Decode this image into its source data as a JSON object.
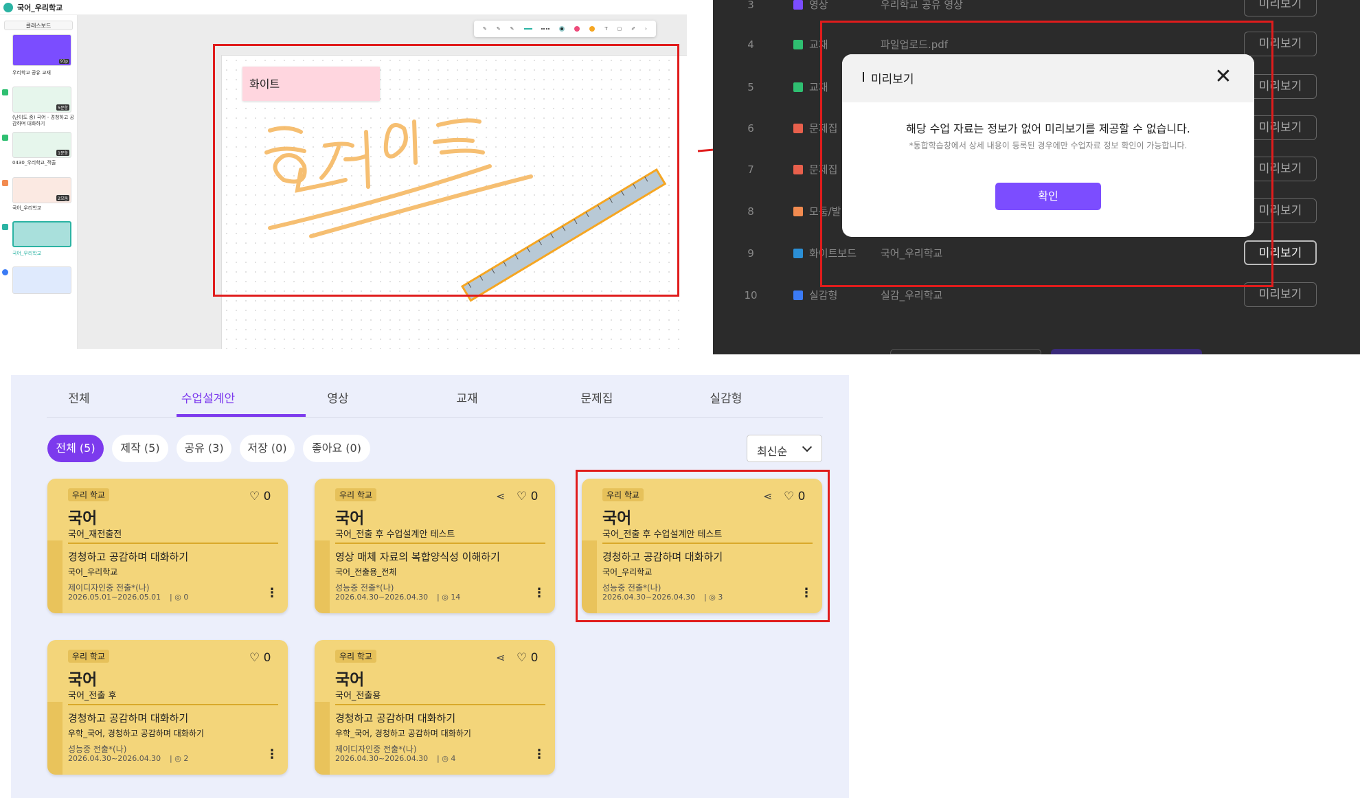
{
  "whiteboard": {
    "title": "국어_우리학교",
    "classboard_label": "클래스보드",
    "thumbnails": [
      {
        "label": "우리학교 공유 교재",
        "badge": "91p"
      },
      {
        "label": "(난이도 중) 국어 - 경청하고 공감하며 대화하기",
        "badge": "5문항"
      },
      {
        "label": "0430_우리학교_적출",
        "badge": "1문항"
      },
      {
        "label": "국어_우리학교",
        "badge": "2모둠"
      },
      {
        "label": "국어_우리학교",
        "badge": ""
      }
    ],
    "sticky_note": "화이트",
    "handwriting": "화이트",
    "colors": {
      "pink_note": "#ffd6df",
      "stroke": "#f5b45a",
      "ruler": "#9fb6c8"
    }
  },
  "dialog": {
    "rows": [
      {
        "n": "3",
        "type": "영상",
        "title": "우리학교 공유 영상",
        "btn": "미리보기"
      },
      {
        "n": "4",
        "type": "교재",
        "title": "파일업로드.pdf",
        "btn": "미리보기"
      },
      {
        "n": "5",
        "type": "교재",
        "title": "",
        "btn": "미리보기"
      },
      {
        "n": "6",
        "type": "문제집",
        "title": "",
        "btn": "미리보기"
      },
      {
        "n": "7",
        "type": "문제집",
        "title": "",
        "btn": "미리보기"
      },
      {
        "n": "8",
        "type": "모둠/발",
        "title": "",
        "btn": "미리보기"
      },
      {
        "n": "9",
        "type": "화이트보드",
        "title": "국어_우리학교",
        "btn": "미리보기"
      },
      {
        "n": "10",
        "type": "실감형",
        "title": "실감_우리학교",
        "btn": "미리보기"
      }
    ],
    "modal_title": "미리보기",
    "modal_message": "해당 수업 자료는 정보가 없어 미리보기를 제공할 수 없습니다.",
    "modal_sub": "*통합학습창에서 상세 내용이 등록된 경우에만 수업자료 정보 확인이 가능합니다.",
    "confirm": "확인"
  },
  "list": {
    "tabs": [
      "전체",
      "수업설계안",
      "영상",
      "교재",
      "문제집",
      "실감형"
    ],
    "active_tab": "수업설계안",
    "filters": [
      "전체 (5)",
      "제작 (5)",
      "공유 (3)",
      "저장 (0)",
      "좋아요 (0)"
    ],
    "sort": "최신순",
    "cards": [
      {
        "tag": "우리 학교",
        "subject": "국어",
        "title": "국어_재전출전",
        "achievement": "경청하고 공감하며 대화하기",
        "meta": "국어_우리학교",
        "author": "제이디자인중 전출*(나)",
        "date": "2026.05.01~2026.05.01",
        "views": "0",
        "likes": "0",
        "shared": false
      },
      {
        "tag": "우리 학교",
        "subject": "국어",
        "title": "국어_전출 후 수업설계안 테스트",
        "achievement": "영상 매체 자료의 복합양식성 이해하기",
        "meta": "국어_전출용_전체",
        "author": "성능중 전출*(나)",
        "date": "2026.04.30~2026.04.30",
        "views": "14",
        "likes": "0",
        "shared": true
      },
      {
        "tag": "우리 학교",
        "subject": "국어",
        "title": "국어_전출 후 수업설계안 테스트",
        "achievement": "경청하고 공감하며 대화하기",
        "meta": "국어_우리학교",
        "author": "성능중 전출*(나)",
        "date": "2026.04.30~2026.04.30",
        "views": "3",
        "likes": "0",
        "shared": true
      },
      {
        "tag": "우리 학교",
        "subject": "국어",
        "title": "국어_전출 후",
        "achievement": "경청하고 공감하며 대화하기",
        "meta": "우학_국어, 경청하고 공감하며 대화하기",
        "author": "성능중 전출*(나)",
        "date": "2026.04.30~2026.04.30",
        "views": "2",
        "likes": "0",
        "shared": false
      },
      {
        "tag": "우리 학교",
        "subject": "국어",
        "title": "국어_전출용",
        "achievement": "경청하고 공감하며 대화하기",
        "meta": "우학_국어, 경청하고 공감하며 대화하기",
        "author": "제이디자인중 전출*(나)",
        "date": "2026.04.30~2026.04.30",
        "views": "4",
        "likes": "0",
        "shared": true
      }
    ],
    "accent": "#7c3aed"
  }
}
